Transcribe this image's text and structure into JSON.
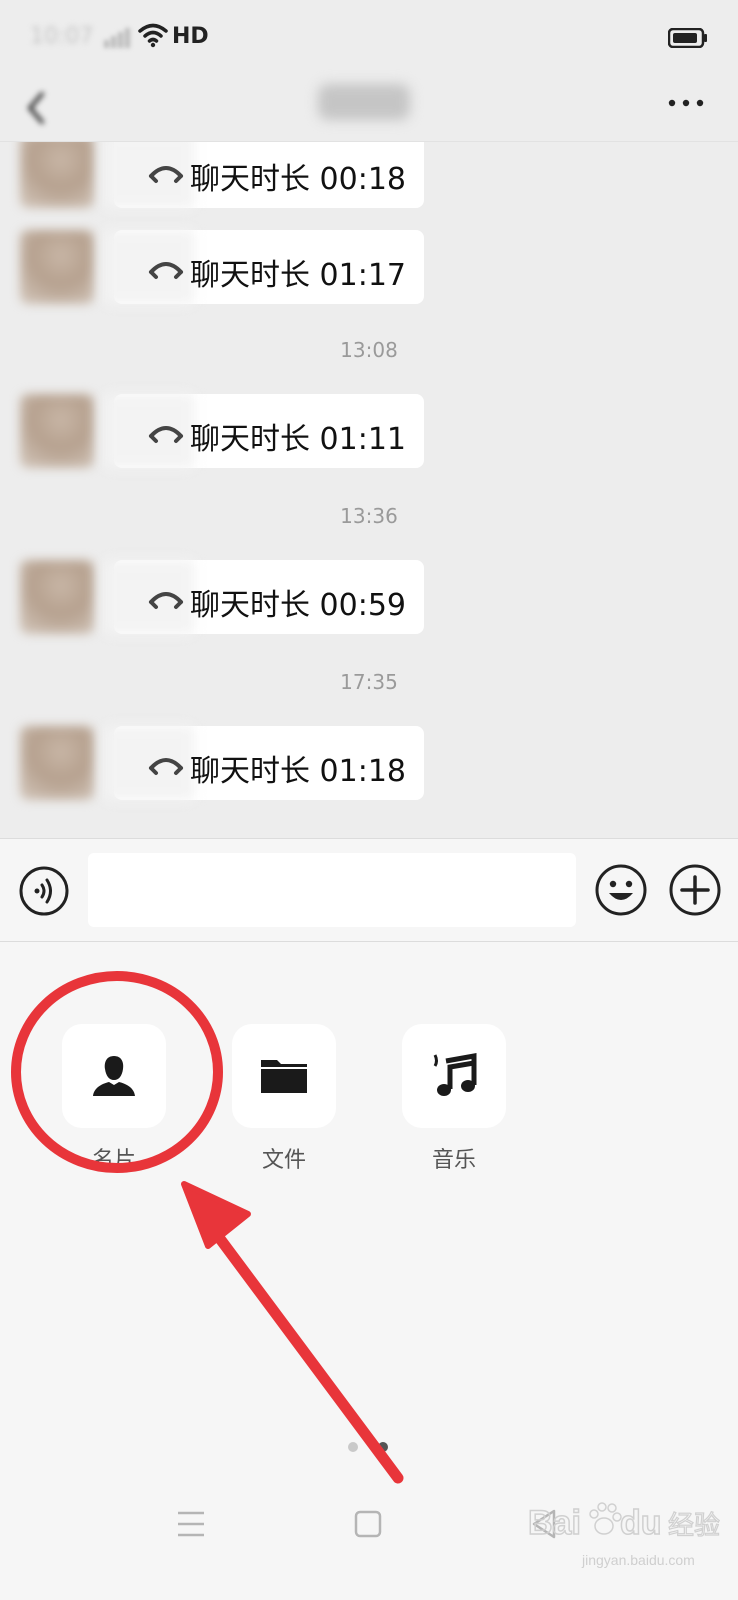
{
  "status_bar": {
    "time": "10:07",
    "network": "HD"
  },
  "header": {
    "title": "",
    "more_icon": "more-horizontal-icon",
    "back_icon": "back-icon"
  },
  "chat": {
    "messages": [
      {
        "text": "聊天时长 00:18"
      },
      {
        "text": "聊天时长 01:17"
      },
      {
        "text": "聊天时长 01:11"
      },
      {
        "text": "聊天时长 00:59"
      },
      {
        "text": "聊天时长 01:18"
      }
    ],
    "timestamps": [
      "13:08",
      "13:36",
      "17:35"
    ]
  },
  "input_bar": {
    "value": "",
    "voice_icon": "voice-icon",
    "emoji_icon": "emoji-icon",
    "plus_icon": "plus-icon"
  },
  "panel": {
    "items": [
      {
        "label": "名片",
        "icon": "person-icon"
      },
      {
        "label": "文件",
        "icon": "folder-icon"
      },
      {
        "label": "音乐",
        "icon": "music-note-icon"
      }
    ],
    "pages_total": 2,
    "current_page": 2
  },
  "nav_bar": {
    "icons": [
      "menu-icon",
      "home-icon",
      "back-triangle-icon"
    ]
  },
  "watermark": {
    "text": "Baidu 经验",
    "url_text": "jingyan.baidu.com"
  },
  "colors": {
    "annotation": "#e8353a",
    "chat_background": "#ededed",
    "panel_background": "#f6f6f6",
    "bubble": "#ffffff"
  }
}
